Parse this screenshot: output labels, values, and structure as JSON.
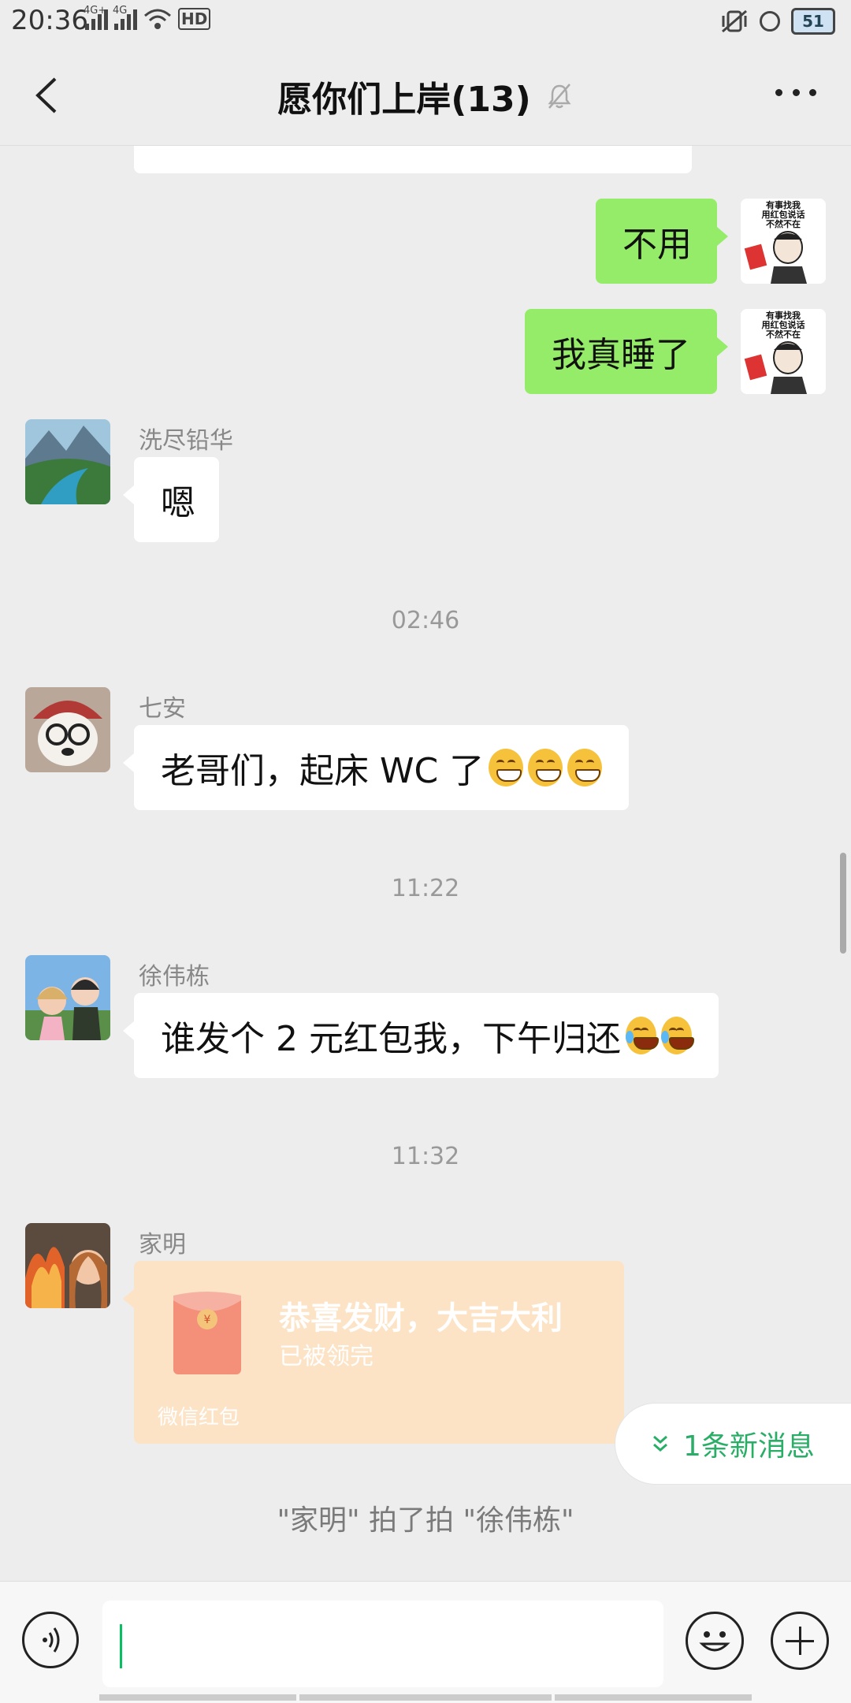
{
  "status_bar": {
    "time": "20:36",
    "network": [
      "4G+",
      "4G"
    ],
    "hd_label": "HD",
    "battery": "51"
  },
  "header": {
    "title": "愿你们上岸(13)",
    "icons": [
      "back-arrow-icon",
      "mute-bell-icon",
      "more-icon"
    ]
  },
  "messages": [
    {
      "side": "right",
      "text": "不用",
      "sticker_text": "有事找我\n用红包说话\n不然不在"
    },
    {
      "side": "right",
      "text": "我真睡了",
      "sticker_text": "有事找我\n用红包说话\n不然不在"
    },
    {
      "side": "left",
      "sender": "洗尽铅华",
      "text": "嗯"
    },
    {
      "type": "time",
      "text": "02:46"
    },
    {
      "side": "left",
      "sender": "七安",
      "text": "老哥们，起床 WC 了",
      "emoji": [
        "grin",
        "grin",
        "grin"
      ]
    },
    {
      "type": "time",
      "text": "11:22"
    },
    {
      "side": "left",
      "sender": "徐伟栋",
      "text": "谁发个 2 元红包我，下午归还",
      "emoji": [
        "tears-of-joy",
        "tears-of-joy"
      ]
    },
    {
      "type": "time",
      "text": "11:32"
    },
    {
      "side": "left",
      "sender": "家明",
      "red_packet": {
        "title": "恭喜发财，大吉大利",
        "status": "已被领完",
        "footer": "微信红包"
      }
    }
  ],
  "new_messages_label": "1条新消息",
  "system_notice": "\"家明\" 拍了拍 \"徐伟栋\"",
  "colors": {
    "background": "#ededed",
    "my_bubble": "#95ec69",
    "accent": "#07c160",
    "red_packet": "#fde3c6"
  }
}
